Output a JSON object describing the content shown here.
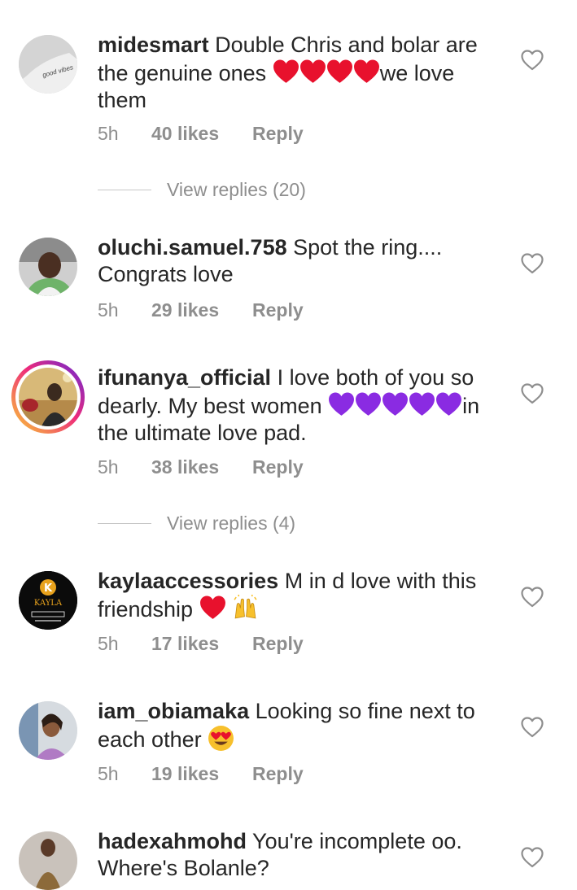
{
  "comments": [
    {
      "username": "midesmart",
      "text_a": "Double Chris and bolar are the genuine ones",
      "text_b": "we love them",
      "time": "5h",
      "likes": "40 likes",
      "reply": "Reply",
      "view_replies": "View replies (20)"
    },
    {
      "username": "oluchi.samuel.758",
      "text_a": "Spot the ring....",
      "text_b": "Congrats love",
      "time": "5h",
      "likes": "29 likes",
      "reply": "Reply"
    },
    {
      "username": "ifunanya_official",
      "text_a": "I love both of you so dearly. My best women",
      "text_b": "in the ultimate love pad.",
      "time": "5h",
      "likes": "38 likes",
      "reply": "Reply",
      "view_replies": "View replies (4)"
    },
    {
      "username": "kaylaaccessories",
      "text_a": "M in d love with this friendship",
      "time": "5h",
      "likes": "17 likes",
      "reply": "Reply",
      "avatar_logo": "KAYLA"
    },
    {
      "username": "iam_obiamaka",
      "text_a": "Looking so fine next to each other",
      "time": "5h",
      "likes": "19 likes",
      "reply": "Reply"
    },
    {
      "username": "hadexahmohd",
      "text_a": "You're incomplete oo.",
      "text_b": "Where's Bolanle?"
    }
  ],
  "colors": {
    "text": "#262626",
    "secondary": "#8e8e8e",
    "red_heart": "#e8112d",
    "purple_heart": "#8a2be2"
  },
  "icons": {
    "like": "heart-outline-icon",
    "red_heart": "red-heart-emoji",
    "purple_heart": "purple-heart-emoji",
    "raising_hands": "raising-hands-emoji",
    "heart_eyes": "heart-eyes-emoji"
  }
}
